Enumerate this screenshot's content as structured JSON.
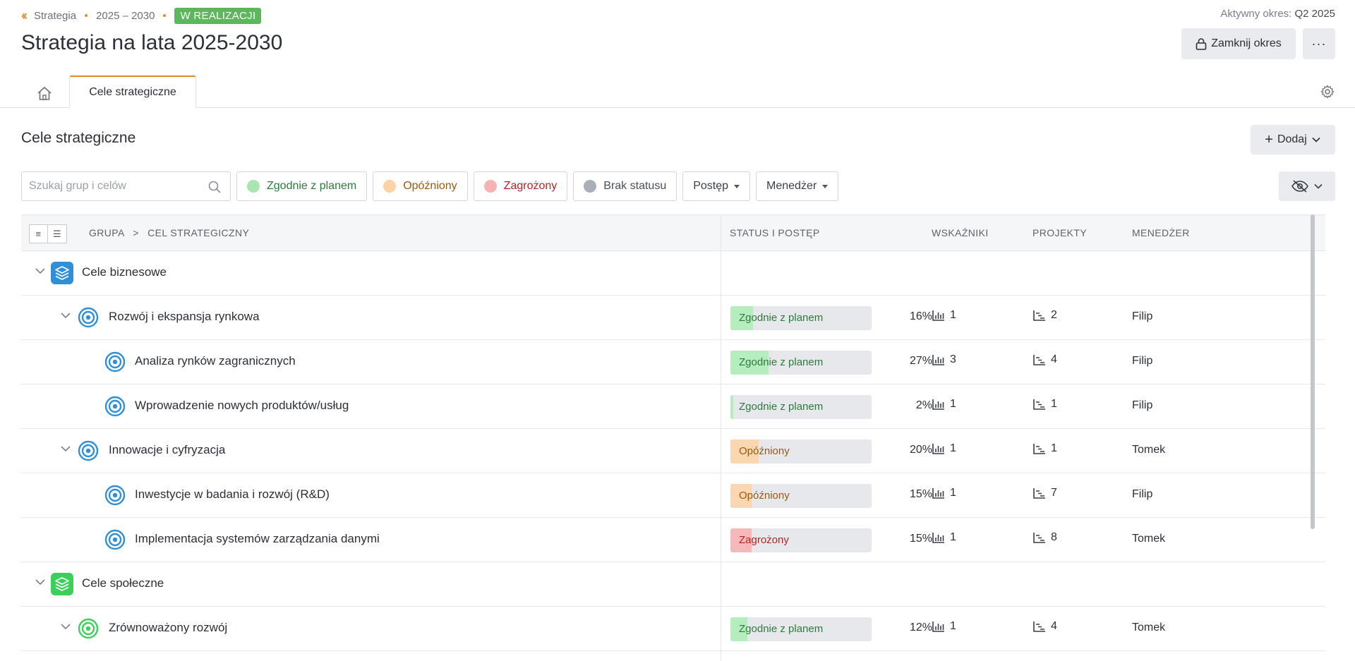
{
  "header": {
    "breadcrumb": {
      "root": "Strategia",
      "period": "2025 – 2030",
      "status": "W REALIZACJI"
    },
    "active_period_label": "Aktywny okres:",
    "active_period_value": "Q2 2025",
    "title": "Strategia na lata 2025-2030",
    "close_period_label": "Zamknij okres",
    "more_label": "···"
  },
  "tabs": [
    {
      "label": "Cele strategiczne"
    }
  ],
  "section": {
    "title": "Cele strategiczne",
    "add_label": "Dodaj"
  },
  "filters": {
    "search_placeholder": "Szukaj grup i celów",
    "status_chips": [
      {
        "label": "Zgodnie z planem",
        "dot": "#a8e6b0",
        "text": "#2d7a3d"
      },
      {
        "label": "Opóźniony",
        "dot": "#fad2a4",
        "text": "#9a5a12"
      },
      {
        "label": "Zagrożony",
        "dot": "#f6b3b3",
        "text": "#b02525"
      },
      {
        "label": "Brak statusu",
        "dot": "#a9afb7",
        "text": "#4a4f57"
      }
    ],
    "dropdowns": [
      "Postęp",
      "Menedżer"
    ]
  },
  "table": {
    "columns": {
      "group": "GRUPA",
      "goal": "CEL STRATEGICZNY",
      "status": "STATUS I POSTĘP",
      "kpis": "WSKAŹNIKI",
      "projects": "PROJEKTY",
      "manager": "MENEDŻER"
    },
    "rows": [
      {
        "level": 0,
        "type": "group",
        "color": "blue",
        "name": "Cele biznesowe"
      },
      {
        "level": 1,
        "type": "goal",
        "color": "blue",
        "name": "Rozwój i ekspansja rynkowa",
        "status": "Zgodnie z planem",
        "status_key": "on",
        "progress": 16,
        "pct": "16%",
        "kpis": "1",
        "projects": "2",
        "manager": "Filip"
      },
      {
        "level": 2,
        "type": "goal",
        "color": "blue",
        "name": "Analiza rynków zagranicznych",
        "status": "Zgodnie z planem",
        "status_key": "on",
        "progress": 27,
        "pct": "27%",
        "kpis": "3",
        "projects": "4",
        "manager": "Filip"
      },
      {
        "level": 2,
        "type": "goal",
        "color": "blue",
        "name": "Wprowadzenie nowych produktów/usług",
        "status": "Zgodnie z planem",
        "status_key": "on",
        "progress": 2,
        "pct": "2%",
        "kpis": "1",
        "projects": "1",
        "manager": "Filip"
      },
      {
        "level": 1,
        "type": "goal",
        "color": "blue",
        "name": "Innowacje i cyfryzacja",
        "status": "Opóźniony",
        "status_key": "late",
        "progress": 20,
        "pct": "20%",
        "kpis": "1",
        "projects": "1",
        "manager": "Tomek"
      },
      {
        "level": 2,
        "type": "goal",
        "color": "blue",
        "name": "Inwestycje w badania i rozwój (R&D)",
        "status": "Opóźniony",
        "status_key": "late",
        "progress": 15,
        "pct": "15%",
        "kpis": "1",
        "projects": "7",
        "manager": "Filip"
      },
      {
        "level": 2,
        "type": "goal",
        "color": "blue",
        "name": "Implementacja systemów zarządzania danymi",
        "status": "Zagrożony",
        "status_key": "risk",
        "progress": 15,
        "pct": "15%",
        "kpis": "1",
        "projects": "8",
        "manager": "Tomek"
      },
      {
        "level": 0,
        "type": "group",
        "color": "green",
        "name": "Cele społeczne"
      },
      {
        "level": 1,
        "type": "goal",
        "color": "green",
        "name": "Zrównoważony rozwój",
        "status": "Zgodnie z planem",
        "status_key": "on",
        "progress": 12,
        "pct": "12%",
        "kpis": "1",
        "projects": "4",
        "manager": "Tomek"
      }
    ]
  },
  "colors": {
    "accent": "#e58a2b",
    "on_fill": "#b6edbf",
    "on_text": "#2d7a3d",
    "late_fill": "#fad7b0",
    "late_text": "#9a5a12",
    "risk_fill": "#f6b8b8",
    "risk_text": "#b02525",
    "blue": "#2f8fd8",
    "green": "#3ccf5a"
  },
  "icons": {
    "home": "home-icon",
    "settings": "gear-icon",
    "search": "search-icon",
    "lock": "lock-icon",
    "eye_off": "eye-off-icon",
    "kpi": "bar-chart-icon",
    "project": "gantt-icon",
    "goal": "target-icon",
    "group": "layers-icon"
  }
}
